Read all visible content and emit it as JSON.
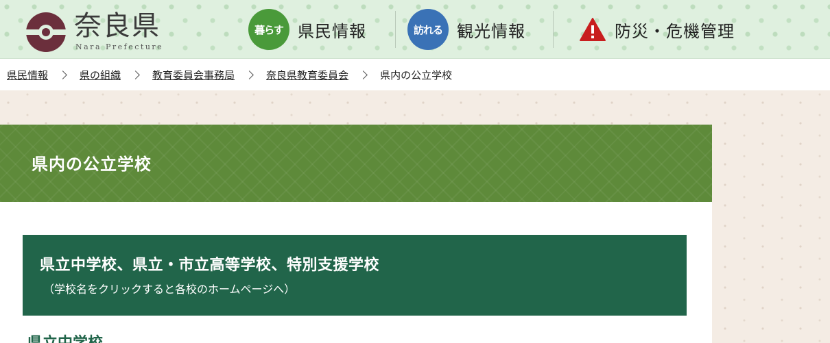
{
  "header": {
    "logo_text": "奈良県",
    "logo_sub": "Nara Prefecture",
    "nav": [
      {
        "badge": "暮らす",
        "label": "県民情報",
        "color": "#4a9a3a"
      },
      {
        "badge": "訪れる",
        "label": "観光情報",
        "color": "#3a72b6"
      },
      {
        "badge": "",
        "label": "防災・危機管理",
        "color": "#c81e1e"
      }
    ]
  },
  "breadcrumb": {
    "items": [
      "県民情報",
      "県の組織",
      "教育委員会事務局",
      "奈良県教育委員会"
    ],
    "current": "県内の公立学校"
  },
  "page": {
    "title": "県内の公立学校"
  },
  "section": {
    "title": "県立中学校、県立・市立高等学校、特別支援学校",
    "note": "（学校名をクリックすると各校のホームページへ）",
    "subheading": "県立中学校"
  },
  "colors": {
    "header_bg": "#dff0df",
    "title_bar": "#5e8a3a",
    "section_header": "#21654a",
    "paper_bg": "#f4ece4"
  }
}
